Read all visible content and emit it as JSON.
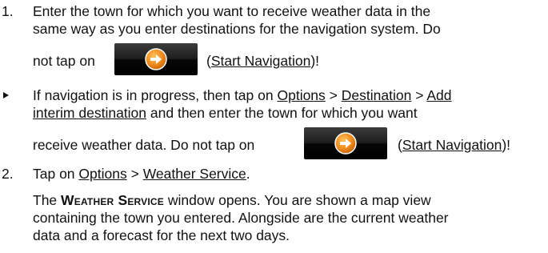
{
  "step1": {
    "number": "1.",
    "line1": "Enter the town for which you want to receive weather data in the",
    "line2": "same way as you enter destinations for the navigation system. Do",
    "pre_button": "not tap on",
    "button_icon": "arrow-right-icon",
    "link": "Start Navigation",
    "post": ")!"
  },
  "bullet": {
    "line1_pre": "If navigation is in progress, then tap on",
    "options": "Options",
    "sep": ">",
    "destination": "Destination",
    "add_interim_part1": "Add",
    "add_interim_part2": "interim destination",
    "line2_post": "and then enter the town for which you want",
    "line3_pre": "receive weather data. Do not tap on",
    "button_icon": "arrow-right-icon",
    "link": "Start Navigation",
    "post": ")!"
  },
  "step2": {
    "number": "2.",
    "pre": "Tap on",
    "options": "Options",
    "sep": ">",
    "weather_service": "Weather Service",
    "end": ".",
    "para_pre": "The",
    "window_name": "Weather Service",
    "para_line1_post": "window opens. You are shown a map view",
    "para_line2": "containing the town you entered. Alongside are the current weather",
    "para_line3": "data and a forecast for the next two days."
  },
  "colors": {
    "button_dark": "#000000",
    "icon_orange": "#f08a1c"
  }
}
